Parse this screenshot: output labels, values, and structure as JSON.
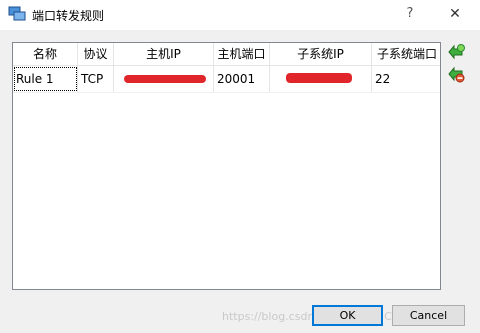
{
  "window": {
    "title": "端口转发规则"
  },
  "titlebar": {
    "help_glyph": "?",
    "close_glyph": "✕"
  },
  "table": {
    "columns": [
      "名称",
      "协议",
      "主机IP",
      "主机端口",
      "子系统IP",
      "子系统端口"
    ],
    "rows": [
      {
        "name": "Rule 1",
        "protocol": "TCP",
        "host_ip": "",
        "host_port": "20001",
        "guest_ip": "",
        "guest_port": "22"
      }
    ]
  },
  "side_buttons": {
    "add_icon": "add-rule-icon",
    "remove_icon": "remove-rule-icon"
  },
  "buttons": {
    "ok_label": "OK",
    "cancel_label": "Cancel"
  },
  "watermark": {
    "text": "https://blog.csdn.net/qq_@51CTO博客"
  },
  "colors": {
    "redaction": "#e0262b",
    "primary_border": "#0078d7"
  }
}
